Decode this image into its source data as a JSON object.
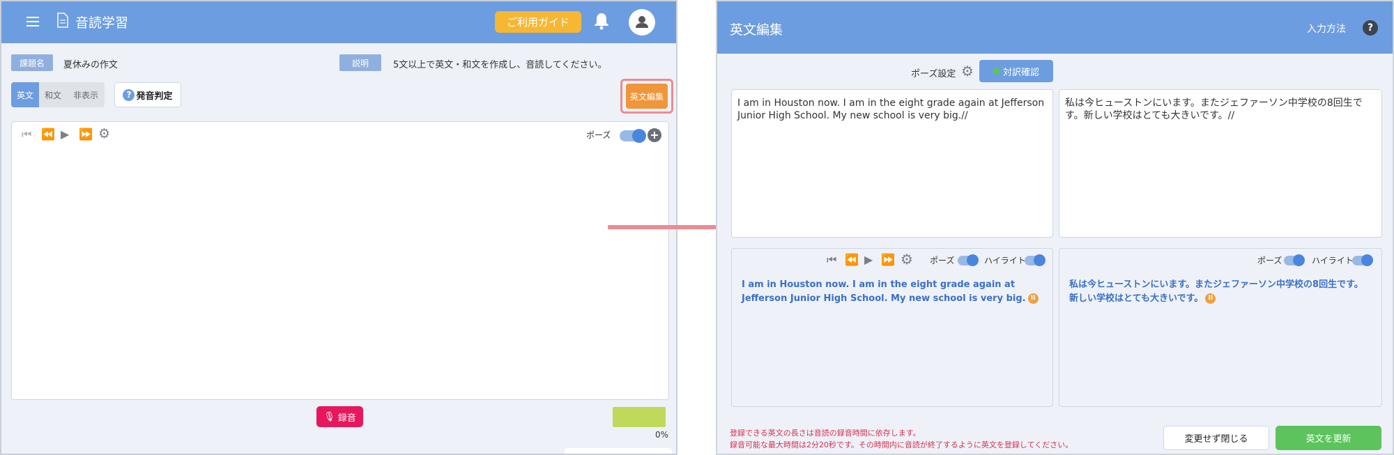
{
  "left": {
    "header": {
      "menu_icon": "hamburger-menu-icon",
      "doc_icon": "document-icon",
      "title": "音読学習",
      "guide_button": "ご利用ガイド",
      "bell_icon": "bell-icon",
      "avatar_icon": "user-avatar-icon"
    },
    "assignment": {
      "name_label": "課題名",
      "name_value": "夏休みの作文",
      "desc_label": "説明",
      "desc_value": "5文以上で英文・和文を作成し、音読してください。"
    },
    "mode_tabs": [
      "英文",
      "和文",
      "非表示"
    ],
    "pronunciation_button": "発音判定",
    "edit_english_button": "英文編集",
    "player": {
      "pause_label": "ポーズ",
      "pause_on": true
    },
    "record_button": "録音",
    "progress_percent": "0%",
    "progress_value": 0
  },
  "right": {
    "header": {
      "title": "英文編集",
      "input_method": "入力方法"
    },
    "pause_settings_label": "ポーズ設定",
    "translation_check_button": "対訳確認",
    "english_text": "I am in Houston now. I am in the eight grade again at Jefferson Junior High School. My new school is very big.//",
    "japanese_text": "私は今ヒューストンにいます。またジェファーソン中学校の8回生です。新しい学校はとても大きいです。//",
    "preview_left": {
      "pause_label": "ポーズ",
      "highlight_label": "ハイライト",
      "text": "I am in Houston now. I am in the eight grade again at Jefferson Junior High School. My new school is very big.",
      "pause_mark": "II"
    },
    "preview_right": {
      "pause_label": "ポーズ",
      "highlight_label": "ハイライト",
      "text": "私は今ヒューストンにいます。またジェファーソン中学校の8回生です。新しい学校はとても大きいです。",
      "pause_mark": "II"
    },
    "notice_line1": "登録できる英文の長さは音読の録音時間に依存します。",
    "notice_line2": "録音可能な最大時間は2分20秒です。その時間内に音読が終了するように英文を登録してください。",
    "close_button": "変更せず閉じる",
    "update_button": "英文を更新"
  },
  "colors": {
    "header_blue": "#6c9de0",
    "guide_yellow": "#f7b733",
    "edit_orange": "#f0963a",
    "record_red": "#e8175d",
    "update_green": "#5dc45d",
    "highlight_text_blue": "#3a6fc8",
    "notice_red": "#d9304f",
    "arrow_pink": "#ee8a92"
  }
}
